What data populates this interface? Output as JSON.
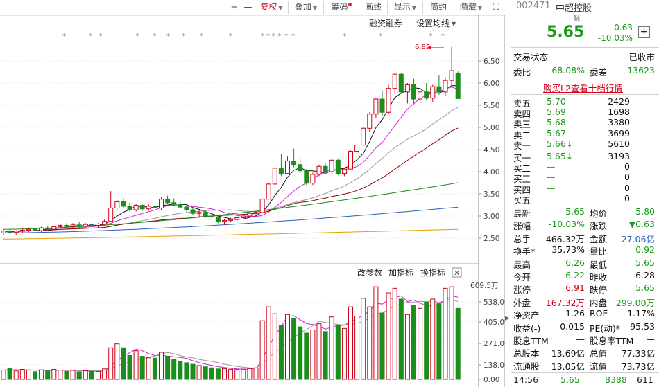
{
  "toolbar": {
    "plus": "+",
    "minus": "—",
    "fuquan": "复权",
    "diejia": "叠加",
    "chouma": "筹码",
    "huixian": "画线",
    "xianshi": "显示",
    "jiantu": "简约",
    "yincang": "隐藏"
  },
  "chart": {
    "rzrq": "融资融券",
    "set_ma": "设置均线",
    "marker": "6.82",
    "price_ticks": [
      "6.50",
      "6.00",
      "5.50",
      "5.00",
      "4.50",
      "4.00",
      "3.50",
      "3.00",
      "2.50"
    ],
    "vol_ticks": [
      "609.5万",
      "538.00",
      "405.00",
      "271.00",
      "138.00",
      "0.00"
    ],
    "vol_tools": [
      "改参数",
      "加指标",
      "换指标"
    ],
    "vol_close": "✕"
  },
  "chart_data": {
    "type": "candlestick",
    "note_axis": "price",
    "ylim": [
      2.3,
      6.95
    ],
    "candles": [
      {
        "o": 2.62,
        "h": 2.7,
        "l": 2.58,
        "c": 2.66
      },
      {
        "o": 2.66,
        "h": 2.7,
        "l": 2.6,
        "c": 2.63
      },
      {
        "o": 2.63,
        "h": 2.68,
        "l": 2.58,
        "c": 2.66
      },
      {
        "o": 2.66,
        "h": 2.72,
        "l": 2.62,
        "c": 2.68
      },
      {
        "o": 2.68,
        "h": 2.74,
        "l": 2.64,
        "c": 2.7
      },
      {
        "o": 2.7,
        "h": 2.74,
        "l": 2.64,
        "c": 2.67
      },
      {
        "o": 2.67,
        "h": 2.76,
        "l": 2.64,
        "c": 2.73
      },
      {
        "o": 2.73,
        "h": 2.78,
        "l": 2.66,
        "c": 2.7
      },
      {
        "o": 2.7,
        "h": 2.78,
        "l": 2.68,
        "c": 2.76
      },
      {
        "o": 2.76,
        "h": 2.82,
        "l": 2.72,
        "c": 2.79
      },
      {
        "o": 2.79,
        "h": 2.84,
        "l": 2.74,
        "c": 2.76
      },
      {
        "o": 2.76,
        "h": 2.84,
        "l": 2.72,
        "c": 2.8
      },
      {
        "o": 2.8,
        "h": 2.86,
        "l": 2.74,
        "c": 2.77
      },
      {
        "o": 2.77,
        "h": 2.84,
        "l": 2.74,
        "c": 2.81
      },
      {
        "o": 2.81,
        "h": 2.86,
        "l": 2.76,
        "c": 2.79
      },
      {
        "o": 2.79,
        "h": 2.84,
        "l": 2.74,
        "c": 2.82
      },
      {
        "o": 2.82,
        "h": 2.92,
        "l": 2.78,
        "c": 2.88
      },
      {
        "o": 2.88,
        "h": 3.56,
        "l": 2.86,
        "c": 3.18
      },
      {
        "o": 3.18,
        "h": 3.36,
        "l": 3.14,
        "c": 3.32
      },
      {
        "o": 3.32,
        "h": 3.4,
        "l": 3.18,
        "c": 3.22
      },
      {
        "o": 3.22,
        "h": 3.3,
        "l": 3.1,
        "c": 3.14
      },
      {
        "o": 3.14,
        "h": 3.28,
        "l": 3.1,
        "c": 3.24
      },
      {
        "o": 3.24,
        "h": 3.28,
        "l": 3.12,
        "c": 3.16
      },
      {
        "o": 3.16,
        "h": 3.26,
        "l": 3.12,
        "c": 3.22
      },
      {
        "o": 3.22,
        "h": 3.3,
        "l": 3.16,
        "c": 3.18
      },
      {
        "o": 3.18,
        "h": 3.42,
        "l": 3.14,
        "c": 3.38
      },
      {
        "o": 3.38,
        "h": 3.46,
        "l": 3.28,
        "c": 3.3
      },
      {
        "o": 3.3,
        "h": 3.4,
        "l": 3.22,
        "c": 3.26
      },
      {
        "o": 3.26,
        "h": 3.34,
        "l": 3.18,
        "c": 3.2
      },
      {
        "o": 3.2,
        "h": 3.26,
        "l": 3.1,
        "c": 3.14
      },
      {
        "o": 3.14,
        "h": 3.2,
        "l": 3.02,
        "c": 3.06
      },
      {
        "o": 3.06,
        "h": 3.14,
        "l": 2.98,
        "c": 3.08
      },
      {
        "o": 3.08,
        "h": 3.12,
        "l": 2.96,
        "c": 3.0
      },
      {
        "o": 3.0,
        "h": 3.06,
        "l": 2.92,
        "c": 2.98
      },
      {
        "o": 2.98,
        "h": 3.02,
        "l": 2.84,
        "c": 2.88
      },
      {
        "o": 2.88,
        "h": 2.94,
        "l": 2.8,
        "c": 2.9
      },
      {
        "o": 2.9,
        "h": 2.96,
        "l": 2.86,
        "c": 2.92
      },
      {
        "o": 2.92,
        "h": 2.98,
        "l": 2.88,
        "c": 2.96
      },
      {
        "o": 2.96,
        "h": 3.04,
        "l": 2.92,
        "c": 3.0
      },
      {
        "o": 3.0,
        "h": 3.1,
        "l": 2.98,
        "c": 3.06
      },
      {
        "o": 3.06,
        "h": 3.1,
        "l": 3.04,
        "c": 3.08
      },
      {
        "o": 3.08,
        "h": 3.4,
        "l": 3.06,
        "c": 3.38
      },
      {
        "o": 3.38,
        "h": 3.74,
        "l": 3.38,
        "c": 3.72
      },
      {
        "o": 3.72,
        "h": 4.1,
        "l": 3.72,
        "c": 4.08
      },
      {
        "o": 4.08,
        "h": 4.4,
        "l": 3.9,
        "c": 3.96
      },
      {
        "o": 3.96,
        "h": 4.34,
        "l": 3.94,
        "c": 4.24
      },
      {
        "o": 4.24,
        "h": 4.52,
        "l": 4.1,
        "c": 4.16
      },
      {
        "o": 4.16,
        "h": 4.3,
        "l": 3.98,
        "c": 4.02
      },
      {
        "o": 4.02,
        "h": 4.06,
        "l": 3.7,
        "c": 3.74
      },
      {
        "o": 3.74,
        "h": 3.98,
        "l": 3.7,
        "c": 3.94
      },
      {
        "o": 3.94,
        "h": 4.16,
        "l": 3.9,
        "c": 4.12
      },
      {
        "o": 4.12,
        "h": 4.18,
        "l": 3.96,
        "c": 4.0
      },
      {
        "o": 4.0,
        "h": 4.3,
        "l": 3.96,
        "c": 4.26
      },
      {
        "o": 4.26,
        "h": 4.3,
        "l": 3.92,
        "c": 3.96
      },
      {
        "o": 3.96,
        "h": 4.08,
        "l": 3.9,
        "c": 4.06
      },
      {
        "o": 4.06,
        "h": 4.48,
        "l": 4.06,
        "c": 4.46
      },
      {
        "o": 4.46,
        "h": 4.62,
        "l": 4.42,
        "c": 4.6
      },
      {
        "o": 4.6,
        "h": 5.02,
        "l": 4.58,
        "c": 4.98
      },
      {
        "o": 4.98,
        "h": 5.34,
        "l": 4.9,
        "c": 5.3
      },
      {
        "o": 5.3,
        "h": 5.66,
        "l": 5.2,
        "c": 5.64
      },
      {
        "o": 5.64,
        "h": 5.84,
        "l": 5.26,
        "c": 5.34
      },
      {
        "o": 5.34,
        "h": 5.96,
        "l": 5.3,
        "c": 5.88
      },
      {
        "o": 5.88,
        "h": 6.22,
        "l": 5.76,
        "c": 6.2
      },
      {
        "o": 6.2,
        "h": 6.22,
        "l": 5.76,
        "c": 5.8
      },
      {
        "o": 5.8,
        "h": 6.0,
        "l": 5.54,
        "c": 5.96
      },
      {
        "o": 5.96,
        "h": 6.1,
        "l": 5.52,
        "c": 5.64
      },
      {
        "o": 5.64,
        "h": 5.88,
        "l": 5.5,
        "c": 5.8
      },
      {
        "o": 5.8,
        "h": 6.0,
        "l": 5.62,
        "c": 5.66
      },
      {
        "o": 5.66,
        "h": 5.96,
        "l": 5.58,
        "c": 5.92
      },
      {
        "o": 5.92,
        "h": 6.18,
        "l": 5.74,
        "c": 5.8
      },
      {
        "o": 5.8,
        "h": 6.12,
        "l": 5.7,
        "c": 6.06
      },
      {
        "o": 6.06,
        "h": 6.82,
        "l": 5.9,
        "c": 6.28
      },
      {
        "o": 6.22,
        "h": 6.26,
        "l": 5.65,
        "c": 5.65
      }
    ],
    "volume": [
      60,
      70,
      55,
      65,
      60,
      50,
      62,
      55,
      65,
      60,
      52,
      58,
      50,
      56,
      52,
      50,
      68,
      205,
      230,
      205,
      155,
      185,
      150,
      140,
      138,
      175,
      150,
      130,
      118,
      108,
      98,
      90,
      82,
      75,
      68,
      70,
      66,
      64,
      66,
      70,
      75,
      380,
      470,
      425,
      350,
      420,
      395,
      340,
      300,
      320,
      360,
      310,
      405,
      350,
      330,
      470,
      410,
      525,
      470,
      600,
      430,
      560,
      590,
      520,
      420,
      480,
      460,
      500,
      520,
      490,
      590,
      600,
      460
    ]
  },
  "quote": {
    "code": "002471",
    "name": "中超控股",
    "rong": "融",
    "price": "5.65",
    "change": "-0.63",
    "pct": "-10.03%",
    "status_label": "交易状态",
    "status": "已收市",
    "weibi_label": "委比",
    "weibi": "-68.08%",
    "weicha_label": "委差",
    "weicha": "-13623",
    "l2_link": "购买L2查看十档行情"
  },
  "asks": [
    {
      "label": "卖五",
      "price": "5.70",
      "vol": "2429"
    },
    {
      "label": "卖四",
      "price": "5.69",
      "vol": "1698"
    },
    {
      "label": "卖三",
      "price": "5.68",
      "vol": "3380"
    },
    {
      "label": "卖二",
      "price": "5.67",
      "vol": "3699"
    },
    {
      "label": "卖一",
      "price": "5.66↓",
      "vol": "5610"
    }
  ],
  "bids": [
    {
      "label": "买一",
      "price": "5.65↓",
      "vol": "3193"
    },
    {
      "label": "买二",
      "price": "—",
      "vol": "0"
    },
    {
      "label": "买三",
      "price": "—",
      "vol": "0"
    },
    {
      "label": "买四",
      "price": "—",
      "vol": "0"
    },
    {
      "label": "买五",
      "price": "—",
      "vol": "0"
    }
  ],
  "stats": [
    {
      "l1": "最新",
      "v1": "5.65",
      "c1": "dn",
      "l2": "均价",
      "v2": "5.80",
      "c2": "dn"
    },
    {
      "l1": "涨幅",
      "v1": "-10.03%",
      "c1": "dn",
      "l2": "涨跌",
      "v2": "▼0.63",
      "c2": "dn"
    },
    {
      "l1": "总手",
      "v1": "466.32万",
      "c1": "bk",
      "l2": "金额",
      "v2": "27.06亿",
      "c2": "blue"
    },
    {
      "l1": "换手*",
      "v1": "35.73%",
      "c1": "bk",
      "l2": "量比",
      "v2": "0.92",
      "c2": "dn"
    },
    {
      "l1": "最高",
      "v1": "6.26",
      "c1": "dn",
      "l2": "最低",
      "v2": "5.65",
      "c2": "dn"
    },
    {
      "l1": "今开",
      "v1": "6.22",
      "c1": "dn",
      "l2": "昨收",
      "v2": "6.28",
      "c2": "bk"
    },
    {
      "l1": "涨停",
      "v1": "6.91",
      "c1": "up",
      "l2": "跌停",
      "v2": "5.65",
      "c2": "dn"
    },
    {
      "l1": "外盘",
      "v1": "167.32万",
      "c1": "up",
      "l2": "内盘",
      "v2": "299.00万",
      "c2": "dn"
    },
    {
      "l1": "净资产",
      "v1": "1.26",
      "c1": "bk",
      "l2": "ROE",
      "v2": "-1.17%",
      "c2": "bk"
    },
    {
      "l1": "收益(-)",
      "v1": "-0.015",
      "c1": "bk",
      "l2": "PE(动)*",
      "v2": "-95.53",
      "c2": "bk"
    },
    {
      "l1": "股息TTM",
      "v1": "—",
      "c1": "bk",
      "l2": "股息率TTM",
      "v2": "—",
      "c2": "bk"
    },
    {
      "l1": "总股本",
      "v1": "13.69亿",
      "c1": "bk",
      "l2": "总值",
      "v2": "77.33亿",
      "c2": "bk"
    },
    {
      "l1": "流通股",
      "v1": "13.05亿",
      "c1": "bk",
      "l2": "流值",
      "v2": "73.73亿",
      "c2": "bk"
    }
  ],
  "tick": {
    "time": "14:56",
    "price": "5.65",
    "vol": "8388",
    "num": "611"
  }
}
